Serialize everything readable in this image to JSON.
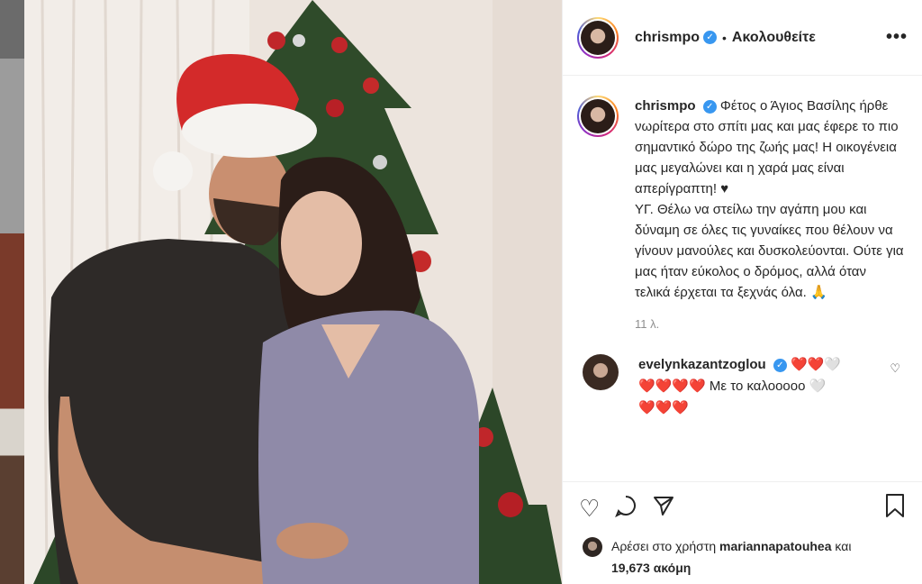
{
  "header": {
    "username": "chrismpo",
    "separator": "•",
    "follow_label": "Ακολουθείτε",
    "more_label": "•••"
  },
  "caption": {
    "username": "chrismpo",
    "text": "Φέτος ο Άγιος Βασίλης ήρθε νωρίτερα στο σπίτι μας και μας έφερε το πιο σημαντικό δώρο της ζωής μας! Η οικογένεια μας μεγαλώνει και η χαρά μας είναι απερίγραπτη! ♥",
    "text2": "ΥΓ. Θέλω να στείλω την αγάπη μου και δύναμη σε όλες τις γυναίκες που θέλουν να γίνουν μανούλες και δυσκολεύονται. Ούτε για μας ήταν εύκολος ο δρόμος, αλλά όταν τελικά έρχεται τα ξεχνάς όλα. 🙏",
    "time": "11 λ."
  },
  "comment": {
    "username": "evelynkazantzoglou",
    "hearts1": "❤️❤️🤍",
    "hearts2": "❤️❤️❤️❤️",
    "text": "Με το καλοοοοο 🤍",
    "hearts3": "❤️❤️❤️",
    "like_icon": "heart-outline-icon"
  },
  "actions": {
    "like_icon": "heart-outline-icon",
    "comment_icon": "comment-icon",
    "share_icon": "paper-plane-icon",
    "save_icon": "bookmark-icon"
  },
  "likes": {
    "prefix": "Αρέσει στο χρήστη",
    "username": "mariannapatouhea",
    "conj": "και",
    "count": "19,673 ακόμη"
  },
  "colors": {
    "verified": "#3897f0",
    "hat_red": "#d32a2a",
    "tree_green": "#2f4b2a"
  }
}
